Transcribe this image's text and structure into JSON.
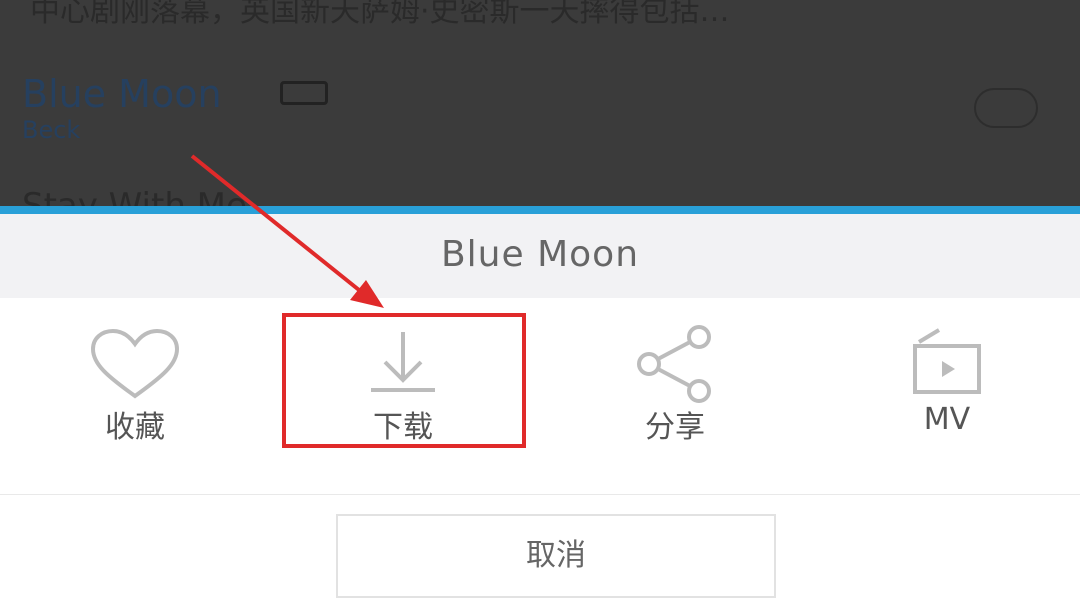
{
  "background": {
    "description_text": "中心剧刚落幕，英国新天萨姆·史密斯一天摔得包括…",
    "song": {
      "title": "Blue Moon",
      "artist": "Beck"
    },
    "next_song_peek": "Stay With Me"
  },
  "sheet": {
    "title": "Blue Moon",
    "actions": [
      {
        "label": "收藏",
        "icon": "heart-icon"
      },
      {
        "label": "下载",
        "icon": "download-icon"
      },
      {
        "label": "分享",
        "icon": "share-icon"
      },
      {
        "label": "MV",
        "icon": "mv-icon"
      }
    ],
    "cancel_label": "取消"
  },
  "colors": {
    "accent": "#29a0d8",
    "annotation": "#e02a2a"
  }
}
